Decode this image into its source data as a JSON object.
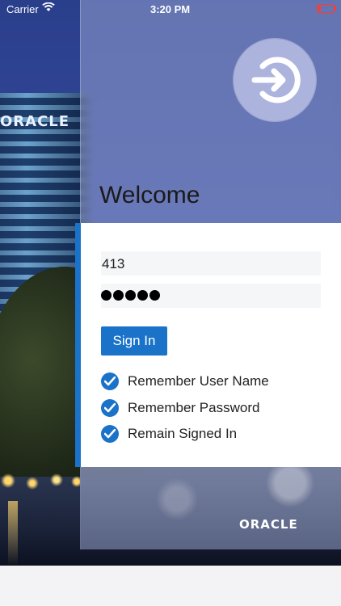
{
  "status_bar": {
    "carrier": "Carrier",
    "time": "3:20 PM",
    "battery_color": "#ff3b30"
  },
  "background": {
    "building_sign": "ORACLE"
  },
  "header": {
    "welcome": "Welcome",
    "signin_icon": "sign-in-arrow-icon"
  },
  "form": {
    "username_value": "413",
    "password_mask": "●●●●●",
    "signin_label": "Sign In",
    "options": [
      {
        "label": "Remember User Name",
        "checked": true
      },
      {
        "label": "Remember Password",
        "checked": true
      },
      {
        "label": "Remain Signed In",
        "checked": true
      }
    ]
  },
  "branding": {
    "logo_text": "ORACLE"
  },
  "colors": {
    "accent": "#1a73c8"
  }
}
